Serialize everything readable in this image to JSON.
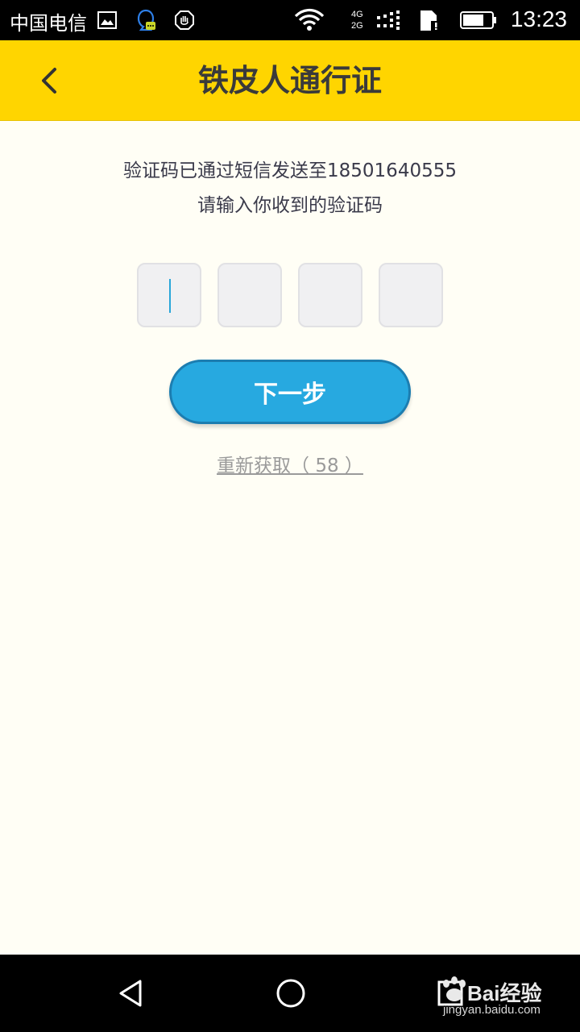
{
  "status_bar": {
    "carrier": "中国电信",
    "network": "4G\n2G",
    "network_top": "4G",
    "network_bottom": "2G",
    "time": "13:23",
    "icons": [
      "gallery-icon",
      "qq-icon",
      "hand-icon",
      "wifi-icon",
      "signal-icon",
      "sim-card-icon",
      "battery-icon"
    ]
  },
  "header": {
    "title": "铁皮人通行证",
    "back_icon": "chevron-left-icon"
  },
  "main": {
    "message_line1": "验证码已通过短信发送至18501640555",
    "message_line2": "请输入你收到的验证码",
    "code_inputs": [
      "",
      "",
      "",
      ""
    ],
    "next_button_label": "下一步",
    "resend_label": "重新获取（ 58 ）"
  },
  "nav_bar": {
    "icons": [
      "back-triangle-icon",
      "home-circle-icon",
      "recent-square-icon"
    ]
  },
  "watermark": {
    "brand": "Bai经验",
    "url": "jingyan.baidu.com"
  },
  "colors": {
    "header": "#FFD500",
    "background": "#FFFEF5",
    "button": "#27A9E0",
    "cursor": "#29A6D9"
  }
}
